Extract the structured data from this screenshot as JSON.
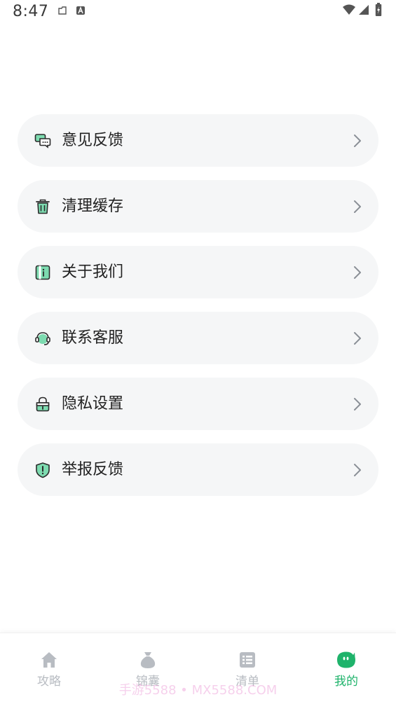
{
  "status_bar": {
    "time": "8:47"
  },
  "menu": {
    "items": [
      {
        "label": "意见反馈",
        "icon": "feedback-chat-icon"
      },
      {
        "label": "清理缓存",
        "icon": "trash-icon"
      },
      {
        "label": "关于我们",
        "icon": "info-card-icon"
      },
      {
        "label": "联系客服",
        "icon": "headset-icon"
      },
      {
        "label": "隐私设置",
        "icon": "lock-icon"
      },
      {
        "label": "举报反馈",
        "icon": "shield-alert-icon"
      }
    ]
  },
  "tabbar": {
    "tabs": [
      {
        "label": "攻略",
        "icon": "home-icon",
        "active": false
      },
      {
        "label": "锦囊",
        "icon": "pouch-icon",
        "active": false
      },
      {
        "label": "清单",
        "icon": "list-icon",
        "active": false
      },
      {
        "label": "我的",
        "icon": "mine-face-icon",
        "active": true
      }
    ]
  },
  "watermark": {
    "text": "手游5588 • MX5588.COM"
  },
  "colors": {
    "accent": "#1fb36b",
    "icon_fill": "#7ddbb0",
    "icon_stroke": "#2b2b2b",
    "item_bg": "#f5f6f7",
    "tab_inactive": "#b8bcc2"
  }
}
